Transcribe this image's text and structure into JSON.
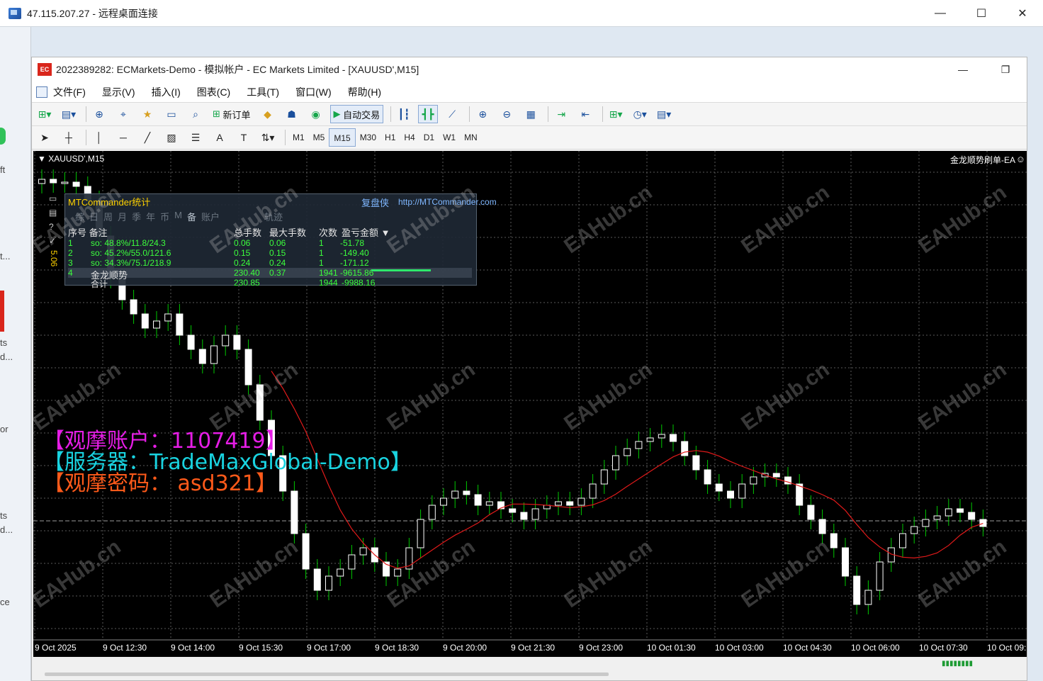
{
  "rdp": {
    "title": "47.115.207.27 - 远程桌面连接",
    "min": "—",
    "max": "☐",
    "close": "✕"
  },
  "left_strip": [
    "ft",
    "t...",
    "ts",
    "d...",
    "or",
    "ts",
    "d...",
    "ce"
  ],
  "mt4": {
    "logo": "EC",
    "title": "2022389282: ECMarkets-Demo - 模拟帐户 - EC Markets Limited - [XAUUSD',M15]",
    "menu": [
      "文件(F)",
      "显示(V)",
      "插入(I)",
      "图表(C)",
      "工具(T)",
      "窗口(W)",
      "帮助(H)"
    ],
    "toolbar": {
      "new_order": "新订单",
      "auto_trade": "自动交易"
    },
    "timeframes": [
      "M1",
      "M5",
      "M15",
      "M30",
      "H1",
      "H4",
      "D1",
      "W1",
      "MN"
    ],
    "active_timeframe": "M15"
  },
  "chart": {
    "symbol": "XAUUSD',M15",
    "ea_name": "金龙顺势刷单-EA",
    "smile": "☺",
    "bg_color": "#000000",
    "bull_color": "#ffffff",
    "bear_color": "#ffffff",
    "wick_color": "#00c800",
    "ma_color": "#e01a1a",
    "side_label": "5.06",
    "x_labels": [
      "9 Oct 2025",
      "9 Oct 12:30",
      "9 Oct 14:00",
      "9 Oct 15:30",
      "9 Oct 17:00",
      "9 Oct 18:30",
      "9 Oct 20:00",
      "9 Oct 21:30",
      "9 Oct 23:00",
      "10 Oct 01:30",
      "10 Oct 03:00",
      "10 Oct 04:30",
      "10 Oct 06:00",
      "10 Oct 07:30",
      "10 Oct 09:"
    ]
  },
  "stats": {
    "title": "MTCommander统计",
    "replay": "复盘侠",
    "link": "http://MTCommander.com",
    "tabs": [
      "综",
      "日",
      "周",
      "月",
      "季",
      "年",
      "币",
      "M",
      "备",
      "账户",
      "轨迹"
    ],
    "headers": {
      "idx_note": "序号 备注",
      "total_lots": "总手数",
      "max_lots": "最大手数",
      "count": "次数",
      "pnl": "盈亏金额 ▼"
    },
    "rows": [
      {
        "idx": "1",
        "note": "so: 48.8%/11.8/24.3",
        "total": "0.06",
        "max": "0.06",
        "count": "1",
        "pnl": "-51.78"
      },
      {
        "idx": "2",
        "note": "so: 45.2%/55.0/121.6",
        "total": "0.15",
        "max": "0.15",
        "count": "1",
        "pnl": "-149.40"
      },
      {
        "idx": "3",
        "note": "so: 34.3%/75.1/218.9",
        "total": "0.24",
        "max": "0.24",
        "count": "1",
        "pnl": "-171.12"
      },
      {
        "idx": "4",
        "note": "金龙顺势",
        "total": "230.40",
        "max": "0.37",
        "count": "1941",
        "pnl": "-9615.86"
      }
    ],
    "total": {
      "label": "合计",
      "total": "230.85",
      "count": "1944",
      "pnl": "-9988.16"
    }
  },
  "overlay": [
    {
      "text": "【观摩账户：1107419】",
      "color": "#e61de6"
    },
    {
      "text": "【服务器：TradeMaxGlobal-Demo】",
      "color": "#19d3e0"
    },
    {
      "text": "【观摩密码： asd321】",
      "color": "#ff5a1a"
    }
  ],
  "watermark_text": "EAHub.cn"
}
